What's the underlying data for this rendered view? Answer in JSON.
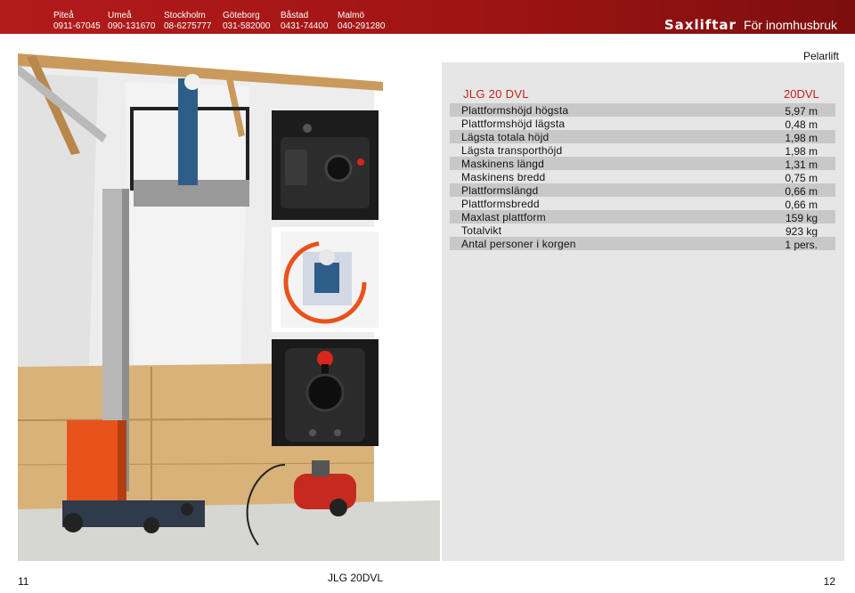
{
  "header": {
    "offices": [
      {
        "city": "Piteå",
        "phone": "0911-67045"
      },
      {
        "city": "Umeå",
        "phone": "090-131670"
      },
      {
        "city": "Stockholm",
        "phone": "08-6275777"
      },
      {
        "city": "Göteborg",
        "phone": "031-582000"
      },
      {
        "city": "Båstad",
        "phone": "0431-74400"
      },
      {
        "city": "Malmö",
        "phone": "040-291280"
      }
    ],
    "brand": "Saxliftar",
    "category": "För inomhusbruk"
  },
  "section_label": "Pelarlift",
  "specs": {
    "model": "JLG 20 DVL",
    "column_header": "20DVL",
    "rows": [
      {
        "label": "Plattformshöjd högsta",
        "value": "5,97 m"
      },
      {
        "label": "Plattformshöjd lägsta",
        "value": "0,48 m"
      },
      {
        "label": "Lägsta totala höjd",
        "value": "1,98 m"
      },
      {
        "label": "Lägsta transporthöjd",
        "value": "1,98 m"
      },
      {
        "label": "Maskinens längd",
        "value": "1,31 m"
      },
      {
        "label": "Maskinens bredd",
        "value": "0,75 m"
      },
      {
        "label": "Plattformslängd",
        "value": "0,66 m"
      },
      {
        "label": "Plattformsbredd",
        "value": "0,66 m"
      },
      {
        "label": "Maxlast plattform",
        "value": "159 kg"
      },
      {
        "label": "Totalvikt",
        "value": "923 kg"
      },
      {
        "label": "Antal personer i korgen",
        "value": "1 pers."
      }
    ]
  },
  "footer": {
    "page_left": "11",
    "title": "JLG 20DVL",
    "page_right": "12"
  },
  "colors": {
    "header_red": "#b31b1b",
    "accent_red": "#c0221f",
    "panel_gray": "#e6e6e6",
    "row_gray": "#c8c8c8",
    "machine_orange": "#e8531c"
  }
}
